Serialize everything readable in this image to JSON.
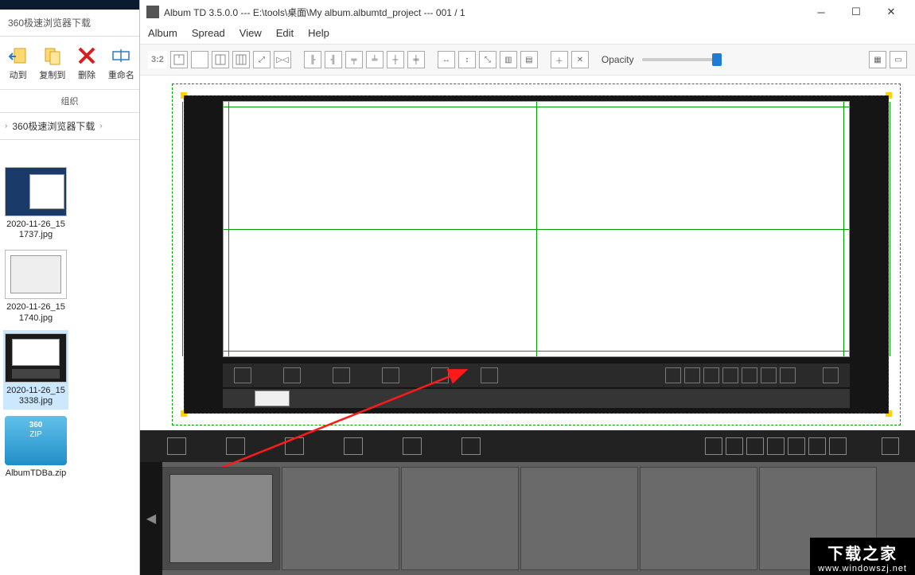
{
  "explorer": {
    "tab_title": "360极速浏览器下载",
    "ribbon": {
      "move": "动到",
      "copy": "复制到",
      "delete": "删除",
      "rename": "重命名",
      "section": "组织"
    },
    "breadcrumb": {
      "folder": "360极速浏览器下载"
    },
    "files": [
      {
        "name": "2020-11-26_151737.jpg"
      },
      {
        "name": "2020-11-26_151740.jpg"
      },
      {
        "name": "2020-11-26_153338.jpg"
      },
      {
        "name": "AlbumTDBa.zip"
      }
    ]
  },
  "app": {
    "title": "Album TD 3.5.0.0 --- E:\\tools\\桌面\\My album.albumtd_project --- 001 / 1",
    "menus": {
      "album": "Album",
      "spread": "Spread",
      "view": "View",
      "edit": "Edit",
      "help": "Help"
    },
    "toolbar": {
      "ratio": "3:2",
      "opacity_label": "Opacity"
    }
  },
  "watermark": {
    "line1": "下载之家",
    "line2": "www.windowszj.net"
  }
}
